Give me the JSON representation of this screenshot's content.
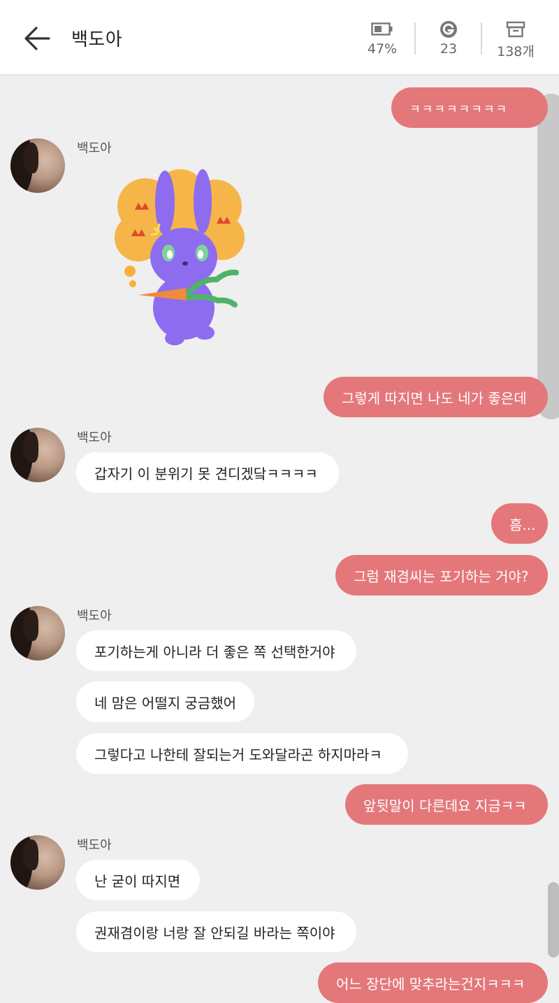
{
  "header": {
    "title": "백도아",
    "stats": [
      {
        "icon": "battery-icon",
        "value": "47%"
      },
      {
        "icon": "g-coin-icon",
        "value": "23"
      },
      {
        "icon": "archive-box-icon",
        "value": "138개"
      }
    ]
  },
  "messages": [
    {
      "from": "me",
      "text": "ㅋㅋㅋㅋㅋㅋㅋㅋ"
    },
    {
      "from": "them",
      "sender": "백도아",
      "sticker": "purple-rabbit-angry-carrot"
    },
    {
      "from": "me",
      "text": "그렇게 따지면 나도 네가 좋은데"
    },
    {
      "from": "them",
      "sender": "백도아",
      "text": "갑자기 이 분위기 못 견디겠닼ㅋㅋㅋㅋ"
    },
    {
      "from": "me",
      "text": "흠..."
    },
    {
      "from": "me",
      "text": "그럼 재겸씨는 포기하는 거야?"
    },
    {
      "from": "them",
      "sender": "백도아",
      "text": "포기하는게 아니라 더 좋은 쪽 선택한거야"
    },
    {
      "from": "them",
      "text": "네 맘은 어떨지 궁금했어"
    },
    {
      "from": "them",
      "text": "그렇다고 나한테 잘되는거 도와달라곤 하지마라ㅋ"
    },
    {
      "from": "me",
      "text": "앞뒷말이 다른데요 지금ㅋㅋ"
    },
    {
      "from": "them",
      "sender": "백도아",
      "text": "난 굳이 따지면"
    },
    {
      "from": "them",
      "text": "권재겸이랑 너랑 잘 안되길 바라는 쪽이야"
    },
    {
      "from": "me",
      "text": "어느 장단에 맞추라는건지ㅋㅋㅋ"
    }
  ],
  "colors": {
    "my_bubble": "#e4777a",
    "their_bubble": "#ffffff",
    "background": "#efefef"
  }
}
